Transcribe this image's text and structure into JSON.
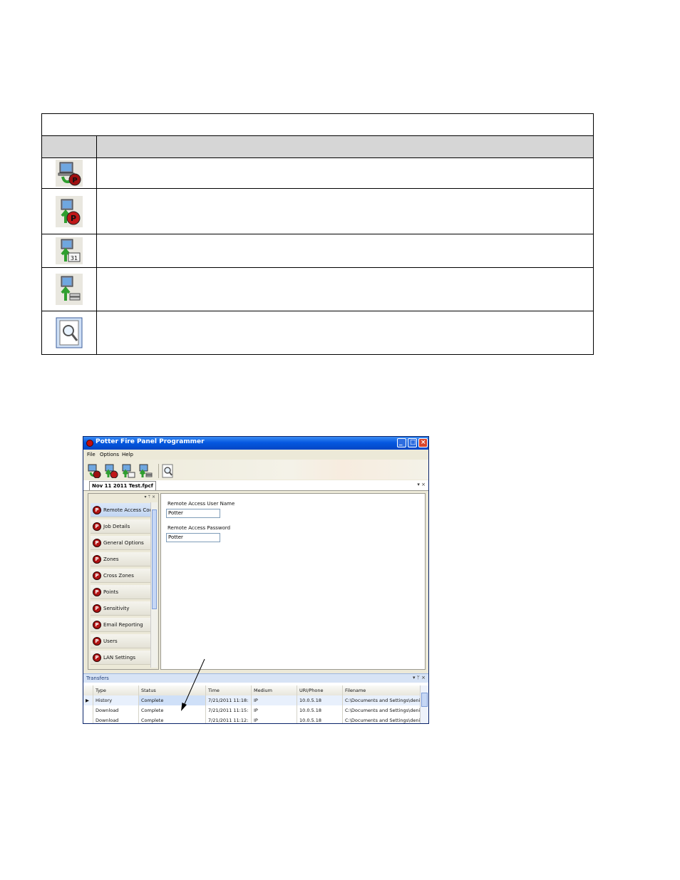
{
  "icon_table": {
    "header_title": "",
    "col_icon": "",
    "col_desc": "",
    "rows": [
      {
        "icon": "download-to-panel-icon",
        "text": ""
      },
      {
        "icon": "upload-from-panel-icon",
        "text": ""
      },
      {
        "icon": "upload-history-icon",
        "text": ""
      },
      {
        "icon": "upload-panel-status-icon",
        "text": ""
      },
      {
        "icon": "print-preview-icon",
        "text": ""
      }
    ]
  },
  "app": {
    "title": "Potter Fire Panel Programmer",
    "menu": [
      "File",
      "Options",
      "Help"
    ],
    "toolbar": [
      {
        "icon": "download-to-panel-icon"
      },
      {
        "icon": "upload-from-panel-icon"
      },
      {
        "icon": "upload-history-icon"
      },
      {
        "icon": "upload-panel-status-icon"
      },
      {
        "icon": "print-preview-icon"
      }
    ],
    "doc_tab": "Nov 11 2011 Test.fpcf",
    "nav_items": [
      {
        "label": "Remote Access Code",
        "active": true
      },
      {
        "label": "Job Details"
      },
      {
        "label": "General Options"
      },
      {
        "label": "Zones"
      },
      {
        "label": "Cross Zones"
      },
      {
        "label": "Points"
      },
      {
        "label": "Sensitivity"
      },
      {
        "label": "Email Reporting"
      },
      {
        "label": "Users"
      },
      {
        "label": "LAN Settings"
      }
    ],
    "content": {
      "user_label": "Remote Access User Name",
      "user_value": "Potter",
      "pass_label": "Remote Access Password",
      "pass_value": "Potter"
    },
    "transfers": {
      "title": "Transfers",
      "columns": [
        "Type",
        "Status",
        "Time",
        "Medium",
        "URI/Phone",
        "Filename"
      ],
      "rows": [
        {
          "type": "History",
          "status": "Complete",
          "time": "7/21/2011 11:18:",
          "medium": "IP",
          "uri": "10.0.5.18",
          "filename": "C:\\Documents and Settings\\denise",
          "selected": true
        },
        {
          "type": "Download",
          "status": "Complete",
          "time": "7/21/2011 11:15:",
          "medium": "IP",
          "uri": "10.0.5.18",
          "filename": "C:\\Documents and Settings\\denise"
        },
        {
          "type": "Download",
          "status": "Complete",
          "time": "7/21/2011 11:12:",
          "medium": "IP",
          "uri": "10.0.5.18",
          "filename": "C:\\Documents and Settings\\denise"
        }
      ]
    }
  },
  "colors": {
    "title_bar": "#0558e0",
    "brand_red": "#b01414",
    "header_gray": "#d6d6d6"
  }
}
